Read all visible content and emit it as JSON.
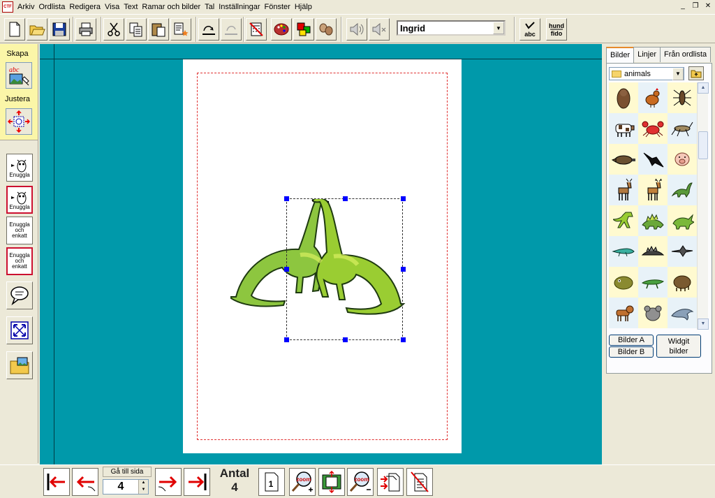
{
  "menubar": {
    "app_icon_text": "CTF",
    "items": [
      "Arkiv",
      "Ordlista",
      "Redigera",
      "Visa",
      "Text",
      "Ramar och bilder",
      "Tal",
      "Inställningar",
      "Fönster",
      "Hjälp"
    ],
    "window_controls": [
      "_",
      "❐",
      "✕"
    ]
  },
  "toolbar": {
    "buttons": [
      "new-document-icon",
      "open-folder-icon",
      "save-icon",
      "print-icon",
      "cut-icon",
      "copy-icon",
      "paste-icon",
      "special-paste-icon",
      "line-style-icon",
      "disabled-undo-icon",
      "calculator-crossed-icon",
      "palette-icon",
      "color-squares-icon",
      "shapes-icon",
      "speaker-icon",
      "speaker-settings-icon",
      "spellcheck-icon",
      "symbol-word-icon"
    ],
    "voice": "Ingrid",
    "spellcheck_label": "abc",
    "symbol_word_top": "hund",
    "symbol_word_bottom": "fido"
  },
  "left_panel": {
    "mode_create": "Skapa",
    "mode_adjust": "Justera",
    "create_icon_text": "abc",
    "buttons": [
      {
        "label": "Enuggla",
        "type": "plain"
      },
      {
        "label": "Enuggla",
        "type": "framed"
      },
      {
        "label_lines": [
          "Enuggla",
          "och",
          "enkatt"
        ],
        "type": "plain"
      },
      {
        "label_lines": [
          "Enuggla",
          "och",
          "enkatt"
        ],
        "type": "framed"
      }
    ]
  },
  "right_panel": {
    "tabs": [
      "Bilder",
      "Linjer",
      "Från ordlista"
    ],
    "active_tab": "Bilder",
    "folder": "animals",
    "grid_rows": 8,
    "grid_cols": 3,
    "images": [
      [
        "bear-icon",
        "rooster-icon",
        "insect-icon"
      ],
      [
        "cow-icon",
        "crab-icon",
        "cricket-icon"
      ],
      [
        "platypus-icon",
        "crow-icon",
        "pig-icon"
      ],
      [
        "deer-icon",
        "deer2-icon",
        "dinosaur-icon"
      ],
      [
        "trex-icon",
        "stegosaurus-icon",
        "triceratops-icon"
      ],
      [
        "lizard-icon",
        "spiky-dino-icon",
        "pterodactyl-icon"
      ],
      [
        "dino-head-icon",
        "crocodile-icon",
        "dino-walk-icon"
      ],
      [
        "dog-icon",
        "koala-icon",
        "dolphin-icon"
      ]
    ],
    "btn_bilder_a": "Bilder A",
    "btn_bilder_b": "Bilder B",
    "btn_widgit_line1": "Widgit",
    "btn_widgit_line2": "bilder"
  },
  "bottom": {
    "goto_label": "Gå till sida",
    "page_value": "4",
    "count_label": "Antal",
    "count_value": "4",
    "page_indicator": "1",
    "zoom_in_text": "zoom",
    "zoom_out_text": "zoom"
  },
  "colors": {
    "canvas_bg": "#0099aa",
    "page_bg": "#ffffff",
    "margin_line": "#e03030",
    "selection_handle": "#0000ff",
    "mode_panel_bg": "#fbf6a8",
    "arrow_red": "#e00000"
  }
}
